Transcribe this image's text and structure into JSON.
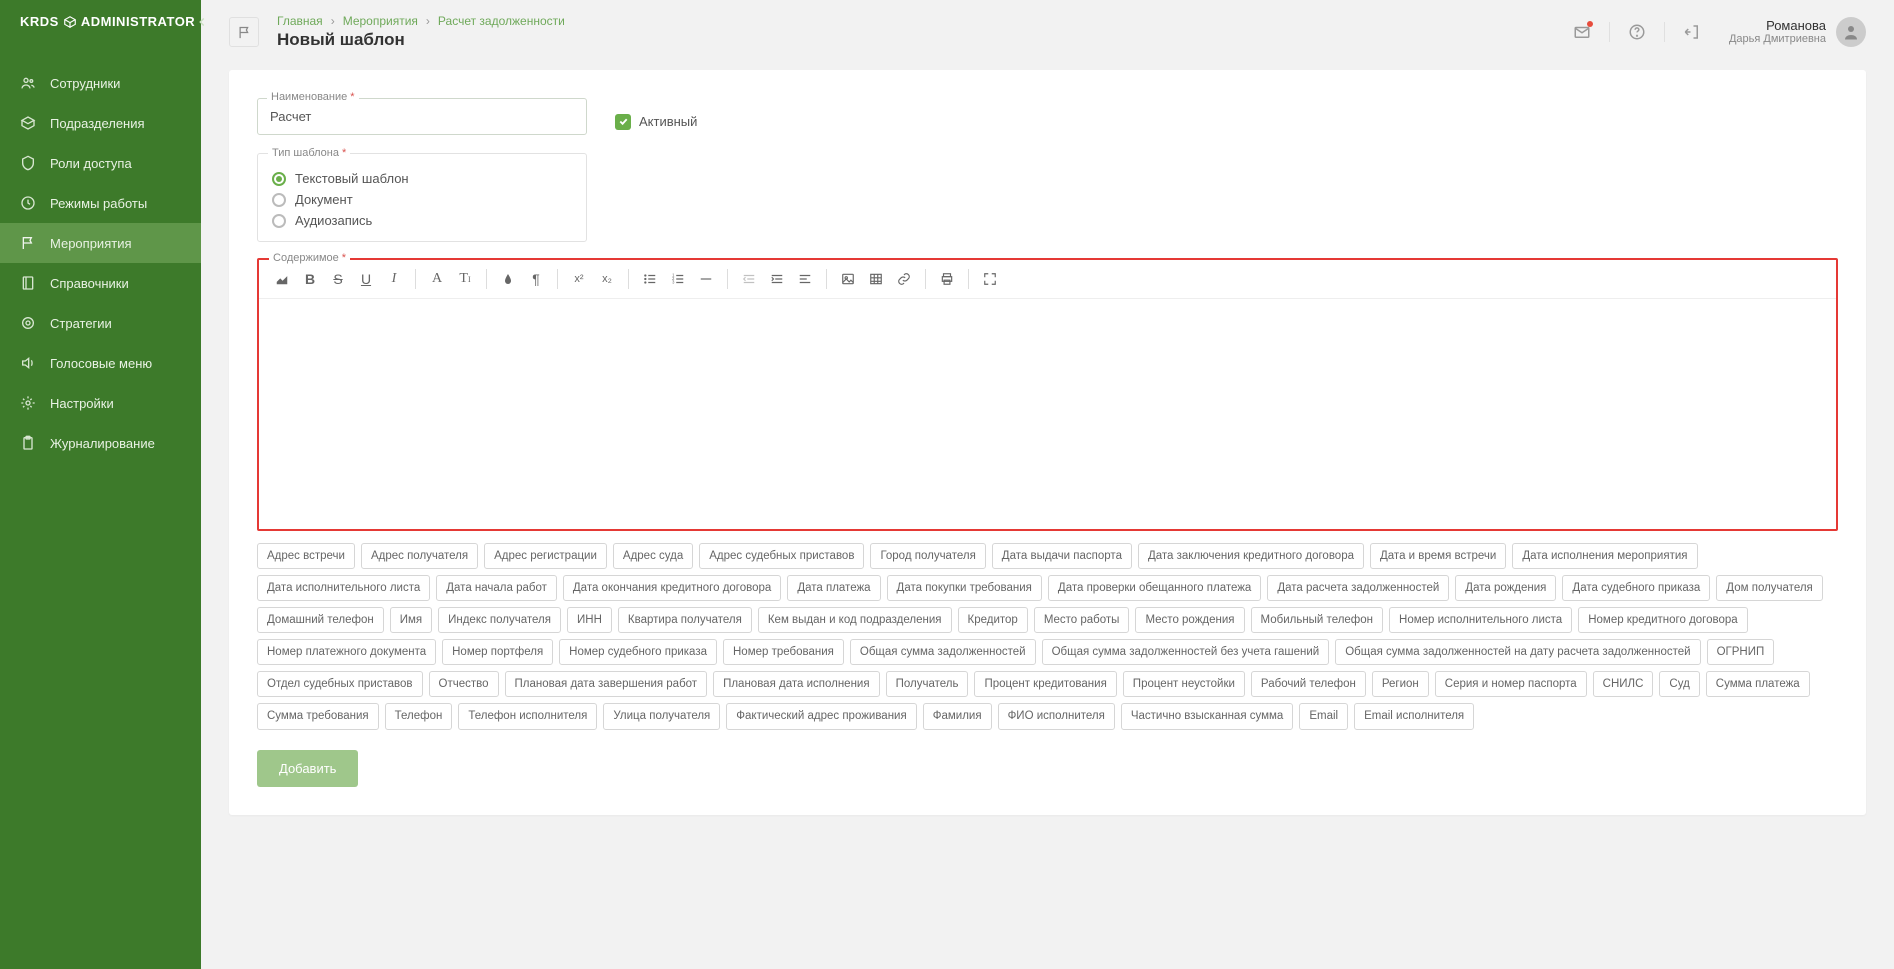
{
  "brand": "KRDS",
  "brand_suffix": "ADMINISTRATOR",
  "sidebar": {
    "items": [
      {
        "label": "Сотрудники"
      },
      {
        "label": "Подразделения"
      },
      {
        "label": "Роли доступа"
      },
      {
        "label": "Режимы работы"
      },
      {
        "label": "Мероприятия"
      },
      {
        "label": "Справочники"
      },
      {
        "label": "Стратегии"
      },
      {
        "label": "Голосовые меню"
      },
      {
        "label": "Настройки"
      },
      {
        "label": "Журналирование"
      }
    ]
  },
  "breadcrumbs": [
    "Главная",
    "Мероприятия",
    "Расчет задолженности"
  ],
  "page_title": "Новый шаблон",
  "user": {
    "surname": "Романова",
    "name": "Дарья Дмитриевна"
  },
  "form": {
    "name_label": "Наименование",
    "name_value": "Расчет",
    "active_label": "Активный",
    "type_label": "Тип шаблона",
    "type_options": [
      "Текстовый шаблон",
      "Документ",
      "Аудиозапись"
    ],
    "content_label": "Содержимое",
    "submit": "Добавить"
  },
  "tags": [
    "Адрес встречи",
    "Адрес получателя",
    "Адрес регистрации",
    "Адрес суда",
    "Адрес судебных приставов",
    "Город получателя",
    "Дата выдачи паспорта",
    "Дата заключения кредитного договора",
    "Дата и время встречи",
    "Дата исполнения мероприятия",
    "Дата исполнительного листа",
    "Дата начала работ",
    "Дата окончания кредитного договора",
    "Дата платежа",
    "Дата покупки требования",
    "Дата проверки обещанного платежа",
    "Дата расчета задолженностей",
    "Дата рождения",
    "Дата судебного приказа",
    "Дом получателя",
    "Домашний телефон",
    "Имя",
    "Индекс получателя",
    "ИНН",
    "Квартира получателя",
    "Кем выдан и код подразделения",
    "Кредитор",
    "Место работы",
    "Место рождения",
    "Мобильный телефон",
    "Номер исполнительного листа",
    "Номер кредитного договора",
    "Номер платежного документа",
    "Номер портфеля",
    "Номер судебного приказа",
    "Номер требования",
    "Общая сумма задолженностей",
    "Общая сумма задолженностей без учета гашений",
    "Общая сумма задолженностей на дату расчета задолженностей",
    "ОГРНИП",
    "Отдел судебных приставов",
    "Отчество",
    "Плановая дата завершения работ",
    "Плановая дата исполнения",
    "Получатель",
    "Процент кредитования",
    "Процент неустойки",
    "Рабочий телефон",
    "Регион",
    "Серия и номер паспорта",
    "СНИЛС",
    "Суд",
    "Сумма платежа",
    "Сумма требования",
    "Телефон",
    "Телефон исполнителя",
    "Улица получателя",
    "Фактический адрес проживания",
    "Фамилия",
    "ФИО исполнителя",
    "Частично взысканная сумма",
    "Email",
    "Email исполнителя"
  ]
}
